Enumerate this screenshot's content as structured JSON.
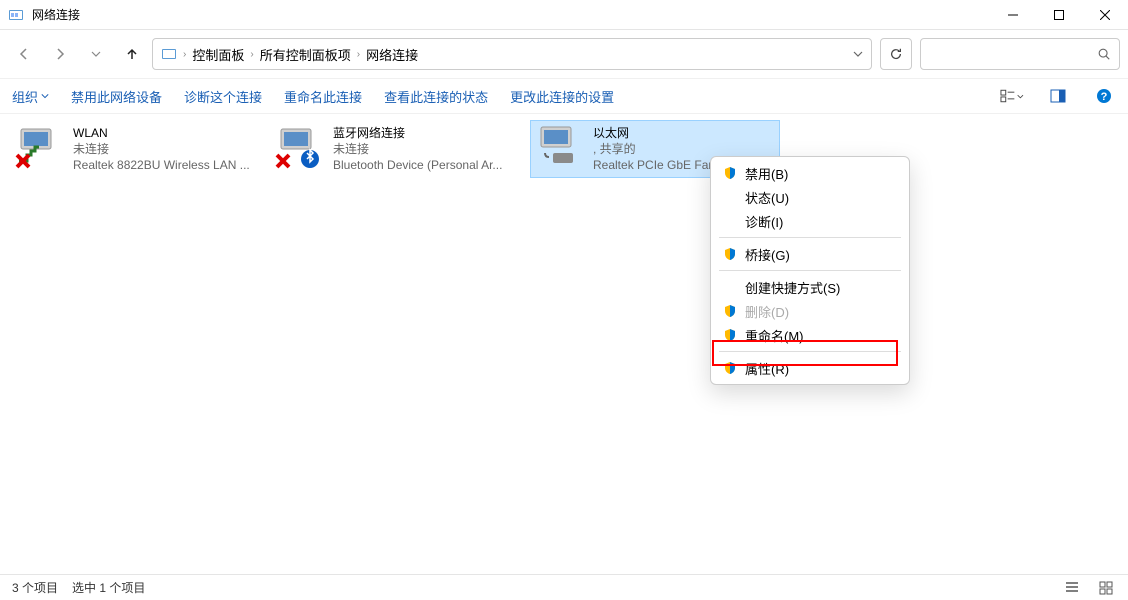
{
  "window": {
    "title": "网络连接"
  },
  "breadcrumbs": [
    "控制面板",
    "所有控制面板项",
    "网络连接"
  ],
  "toolbar": {
    "organize": "组织",
    "disable": "禁用此网络设备",
    "diagnose": "诊断这个连接",
    "rename": "重命名此连接",
    "viewstatus": "查看此连接的状态",
    "changesettings": "更改此连接的设置"
  },
  "connections": [
    {
      "name": "WLAN",
      "status": "未连接",
      "device": "Realtek 8822BU Wireless LAN ..."
    },
    {
      "name": "蓝牙网络连接",
      "status": "未连接",
      "device": "Bluetooth Device (Personal Ar..."
    },
    {
      "name": "以太网",
      "status": ", 共享的",
      "device": "Realtek PCIe GbE Famil..."
    }
  ],
  "contextmenu": {
    "disable": "禁用(B)",
    "status": "状态(U)",
    "diagnose": "诊断(I)",
    "bridge": "桥接(G)",
    "shortcut": "创建快捷方式(S)",
    "delete": "删除(D)",
    "rename": "重命名(M)",
    "properties": "属性(R)"
  },
  "statusbar": {
    "count": "3 个项目",
    "selected": "选中 1 个项目"
  }
}
